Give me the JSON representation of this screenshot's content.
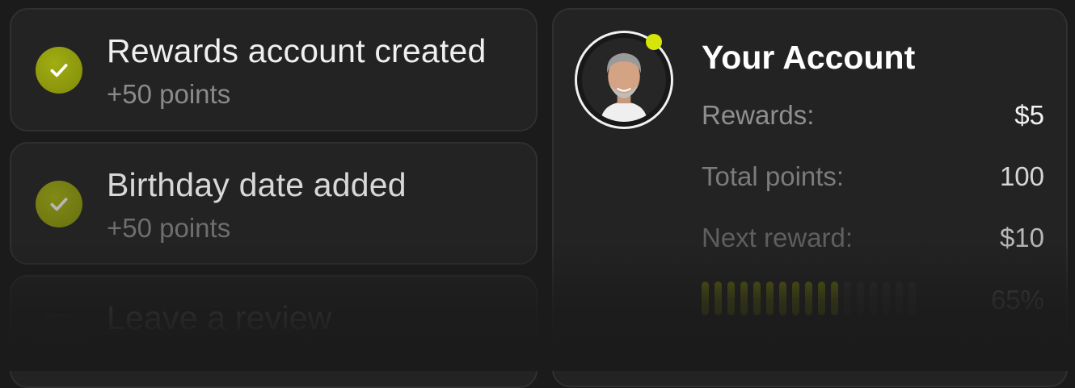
{
  "tasks": [
    {
      "title": "Rewards account created",
      "subtitle": "+50 points",
      "done": true
    },
    {
      "title": "Birthday date added",
      "subtitle": "+50 points",
      "done": true
    },
    {
      "title": "Leave a review",
      "subtitle": "",
      "done": false
    }
  ],
  "account": {
    "title": "Your Account",
    "rewards_label": "Rewards:",
    "rewards_value": "$5",
    "total_points_label": "Total points:",
    "total_points_value": "100",
    "next_reward_label": "Next reward:",
    "next_reward_value": "$10",
    "progress_percent": 65,
    "progress_text": "65%",
    "status": "online"
  },
  "colors": {
    "accent": "#d6e60a",
    "check_fill": "#8a950c",
    "card_bg": "#232323",
    "page_bg": "#1b1b1b"
  },
  "icons": {
    "task_done": "check-icon",
    "avatar": "user-avatar-photo",
    "status": "online-status-dot"
  }
}
